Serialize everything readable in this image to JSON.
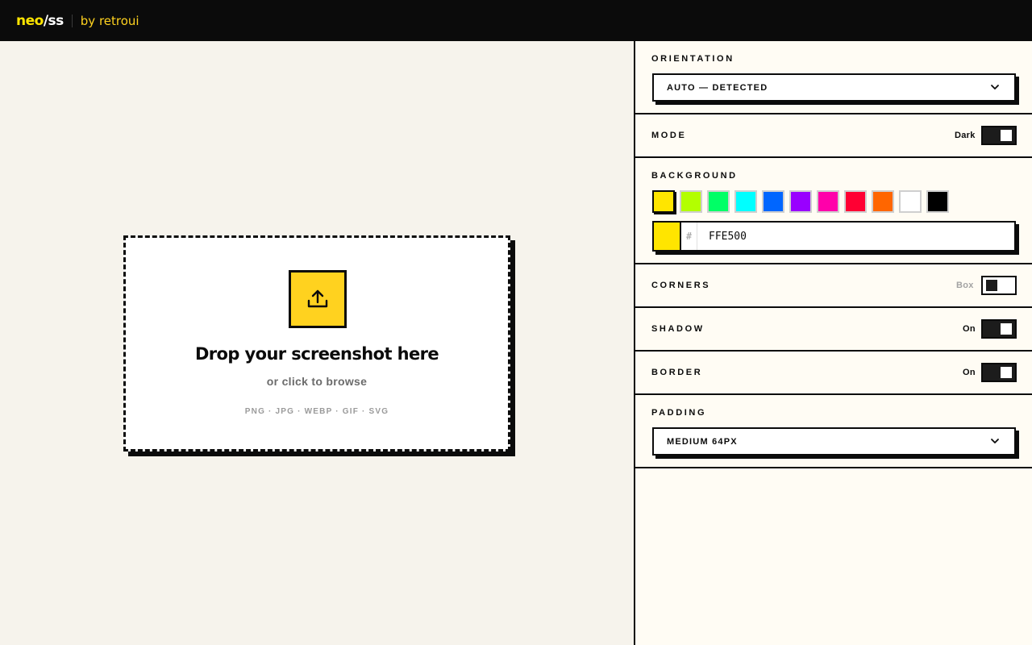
{
  "header": {
    "logo_neo": "neo",
    "logo_slash": "/",
    "logo_ss": "ss",
    "byline": "by retroui"
  },
  "dropzone": {
    "icon": "upload-icon",
    "title": "Drop your screenshot here",
    "subtitle": "or click to browse",
    "formats": "PNG · JPG · WEBP · GIF · SVG"
  },
  "settings": {
    "orientation": {
      "label": "ORIENTATION",
      "value": "AUTO — DETECTED"
    },
    "mode": {
      "label": "MODE",
      "value": "Dark",
      "enabled": true
    },
    "background": {
      "label": "BACKGROUND",
      "swatches": [
        "#FFE500",
        "#B3FF00",
        "#00FF66",
        "#00FFFF",
        "#0066FF",
        "#9900FF",
        "#FF00AA",
        "#FF0033",
        "#FF6600",
        "#FFFFFF",
        "#000000"
      ],
      "selected_index": 0,
      "hash": "#",
      "hex_value": "FFE500"
    },
    "corners": {
      "label": "CORNERS",
      "value": "Box",
      "enabled": false
    },
    "shadow": {
      "label": "SHADOW",
      "value": "On",
      "enabled": true
    },
    "border": {
      "label": "BORDER",
      "value": "On",
      "enabled": true
    },
    "padding": {
      "label": "PADDING",
      "value": "MEDIUM 64PX"
    }
  },
  "colors": {
    "accent": "#FFE500",
    "brand_yellow": "#FFD21F",
    "ink": "#0B0B0B",
    "canvas_bg": "#F6F3EC",
    "panel_bg": "#FFFCF4",
    "muted_label": "#A3A3A3"
  }
}
